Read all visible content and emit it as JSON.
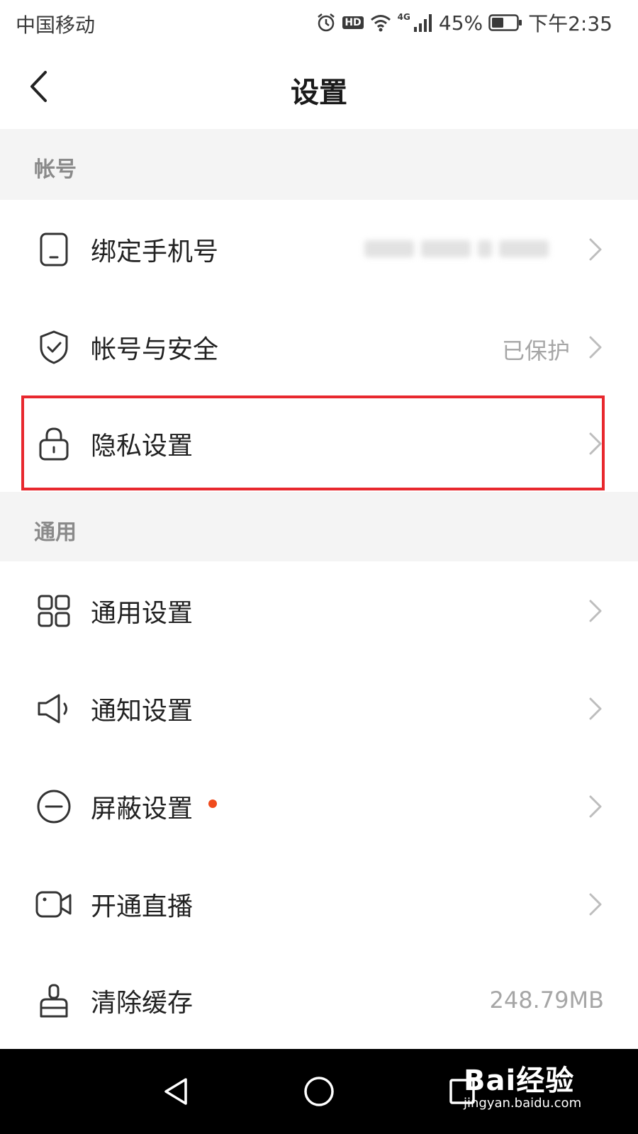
{
  "status_bar": {
    "carrier": "中国移动",
    "network": "4G",
    "hd_badge": "HD",
    "battery": "45%",
    "time": "下午2:35"
  },
  "header": {
    "title": "设置",
    "back_icon": "chevron-left-icon"
  },
  "sections": {
    "account": {
      "label": "帐号",
      "items": [
        {
          "label": "绑定手机号",
          "icon": "phone-icon",
          "value": ""
        },
        {
          "label": "帐号与安全",
          "icon": "shield-check-icon",
          "value": "已保护"
        },
        {
          "label": "隐私设置",
          "icon": "lock-icon",
          "value": ""
        }
      ]
    },
    "general": {
      "label": "通用",
      "items": [
        {
          "label": "通用设置",
          "icon": "grid-icon",
          "value": ""
        },
        {
          "label": "通知设置",
          "icon": "speaker-icon",
          "value": ""
        },
        {
          "label": "屏蔽设置",
          "icon": "block-icon",
          "value": "",
          "badge_dot": true
        },
        {
          "label": "开通直播",
          "icon": "video-camera-icon",
          "value": ""
        },
        {
          "label": "清除缓存",
          "icon": "brush-icon",
          "value": "248.79MB"
        }
      ]
    }
  },
  "highlight_color": "#e8282e",
  "badge_color": "#f04a1c",
  "watermark": {
    "brand": "Bai经验",
    "url": "jingyan.baidu.com"
  }
}
